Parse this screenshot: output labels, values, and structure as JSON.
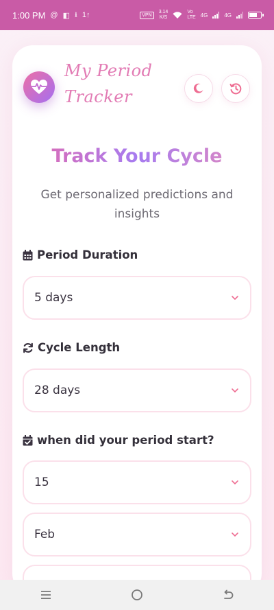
{
  "status_bar": {
    "time": "1:00 PM",
    "left_icons": [
      "threads-icon",
      "outlook-icon",
      "download-check-icon",
      "upload-icon"
    ],
    "vpn": "VPN",
    "speed_value": "3.14",
    "speed_unit": "K/S",
    "network": "4G",
    "battery_level": 0.7
  },
  "header": {
    "app_title_line1": "My Period",
    "app_title_line2": "Tracker",
    "logo_icon": "heart-pulse-icon",
    "theme_button_icon": "moon-icon",
    "history_button_icon": "history-icon"
  },
  "hero": {
    "title": "Track Your Cycle",
    "subtitle": "Get personalized predictions and insights"
  },
  "form": {
    "duration": {
      "label": "Period Duration",
      "icon": "calendar-icon",
      "value": "5 days"
    },
    "cycle": {
      "label": "Cycle Length",
      "icon": "sync-icon",
      "value": "28 days"
    },
    "start": {
      "label": "when did your period start?",
      "icon": "calendar-check-icon",
      "day": "15",
      "month": "Feb",
      "year": ""
    }
  },
  "colors": {
    "status_bar": "#c95ba6",
    "accent_pink": "#e869a8",
    "accent_purple": "#a77cf0",
    "field_border": "#fbe0ea"
  },
  "nav": {
    "menu_icon": "menu-icon",
    "home_icon": "home-circle-icon",
    "back_icon": "back-icon"
  }
}
